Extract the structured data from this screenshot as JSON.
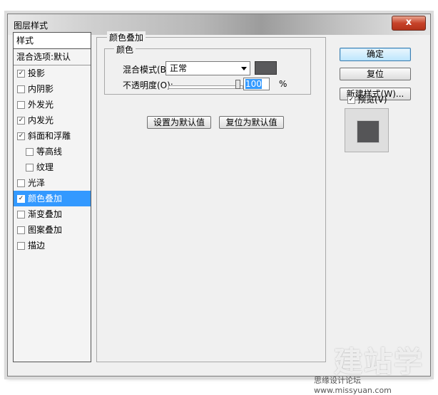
{
  "window": {
    "title": "图层样式",
    "close_label": "x"
  },
  "styles_panel": {
    "header": "样式",
    "blend_options": "混合选项:默认",
    "items": [
      {
        "label": "投影",
        "checked": true,
        "sub": false
      },
      {
        "label": "内阴影",
        "checked": false,
        "sub": false
      },
      {
        "label": "外发光",
        "checked": false,
        "sub": false
      },
      {
        "label": "内发光",
        "checked": true,
        "sub": false
      },
      {
        "label": "斜面和浮雕",
        "checked": true,
        "sub": false
      },
      {
        "label": "等高线",
        "checked": false,
        "sub": true
      },
      {
        "label": "纹理",
        "checked": false,
        "sub": true
      },
      {
        "label": "光泽",
        "checked": false,
        "sub": false
      },
      {
        "label": "颜色叠加",
        "checked": true,
        "sub": false,
        "selected": true
      },
      {
        "label": "渐变叠加",
        "checked": false,
        "sub": false
      },
      {
        "label": "图案叠加",
        "checked": false,
        "sub": false
      },
      {
        "label": "描边",
        "checked": false,
        "sub": false
      }
    ]
  },
  "color_overlay": {
    "group_title": "颜色叠加",
    "sub_group_title": "颜色",
    "blend_mode_label": "混合模式(B):",
    "blend_mode_value": "正常",
    "overlay_color": "#59595b",
    "opacity_label": "不透明度(O):",
    "opacity_value": "100",
    "opacity_unit": "%",
    "opacity_fraction": 1.0,
    "set_default_label": "设置为默认值",
    "reset_default_label": "复位为默认值"
  },
  "right_panel": {
    "ok_label": "确定",
    "reset_label": "复位",
    "new_style_label": "新建样式(W)...",
    "preview_label": "预览(V)",
    "preview_checked": true
  },
  "watermark": {
    "logo": "建站学",
    "caption": "思缘设计论坛  www.missyuan.com"
  }
}
